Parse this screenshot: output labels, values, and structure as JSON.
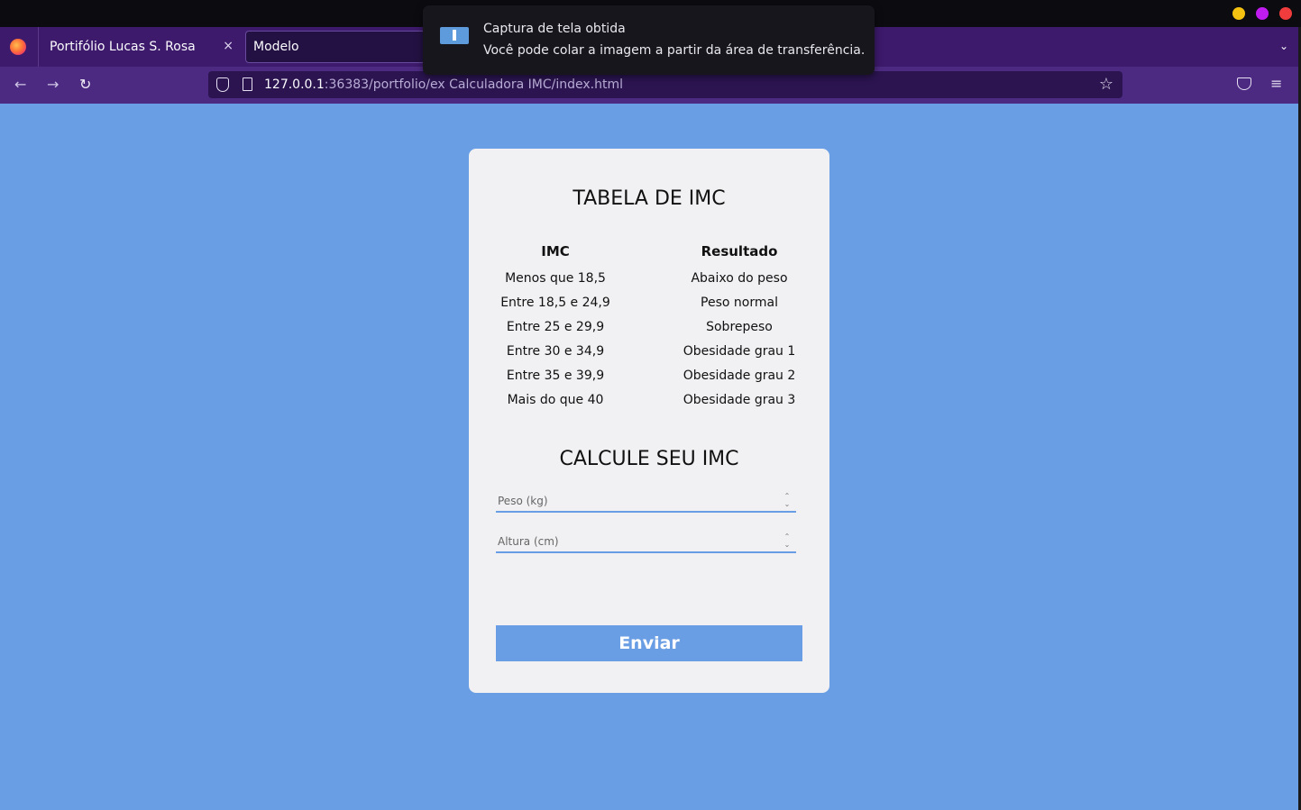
{
  "browser": {
    "tabs": [
      {
        "label": "Portifólio Lucas S. Rosa",
        "close": "×"
      },
      {
        "label": "Modelo"
      }
    ],
    "url_host": "127.0.0.1",
    "url_rest": ":36383/portfolio/ex Calculadora IMC/index.html",
    "icons": {
      "back": "←",
      "forward": "→",
      "reload": "↻",
      "star": "☆",
      "menu": "≡",
      "tabs_list": "⌄"
    },
    "window_controls_colors": [
      "#f5c211",
      "#c01cf0",
      "#f03c3c"
    ]
  },
  "notification": {
    "title": "Captura de tela obtida",
    "message": "Você pode colar a imagem a partir da área de transferência."
  },
  "table": {
    "title": "TABELA DE IMC",
    "headers": [
      "IMC",
      "Resultado"
    ],
    "rows": [
      [
        "Menos que 18,5",
        "Abaixo do peso"
      ],
      [
        "Entre 18,5 e 24,9",
        "Peso normal"
      ],
      [
        "Entre 25 e 29,9",
        "Sobrepeso"
      ],
      [
        "Entre 30 e 34,9",
        "Obesidade grau 1"
      ],
      [
        "Entre 35 e 39,9",
        "Obesidade grau 2"
      ],
      [
        "Mais do que 40",
        "Obesidade grau 3"
      ]
    ]
  },
  "form": {
    "title": "CALCULE SEU IMC",
    "weight_placeholder": "Peso (kg)",
    "height_placeholder": "Altura (cm)",
    "submit_label": "Enviar"
  },
  "colors": {
    "page_bg": "#6a9ee4",
    "card_bg": "#f1f1f3",
    "accent": "#6a9ee4"
  }
}
